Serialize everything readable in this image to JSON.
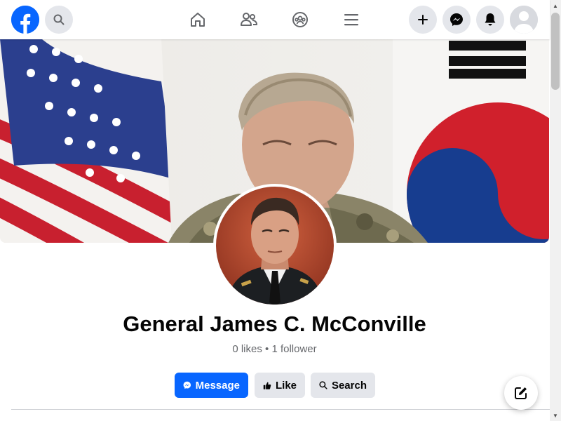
{
  "header": {
    "logo_icon": "facebook-logo-icon",
    "search_icon": "search-icon",
    "nav": [
      {
        "name": "home",
        "icon": "home-icon"
      },
      {
        "name": "friends",
        "icon": "friends-icon"
      },
      {
        "name": "groups",
        "icon": "groups-icon"
      },
      {
        "name": "menu",
        "icon": "hamburger-menu-icon"
      }
    ],
    "actions": [
      {
        "name": "create",
        "icon": "plus-icon"
      },
      {
        "name": "messenger",
        "icon": "messenger-icon"
      },
      {
        "name": "notifications",
        "icon": "bell-icon"
      }
    ],
    "account_icon": "user-avatar-icon"
  },
  "colors": {
    "brand": "#0866ff",
    "secondary_button": "#e4e6eb",
    "text_primary": "#050505",
    "text_secondary": "#65676b"
  },
  "profile": {
    "name": "General James C. McConville",
    "stats": "0 likes • 1 follower"
  },
  "buttons": {
    "message": "Message",
    "like": "Like",
    "search": "Search"
  }
}
